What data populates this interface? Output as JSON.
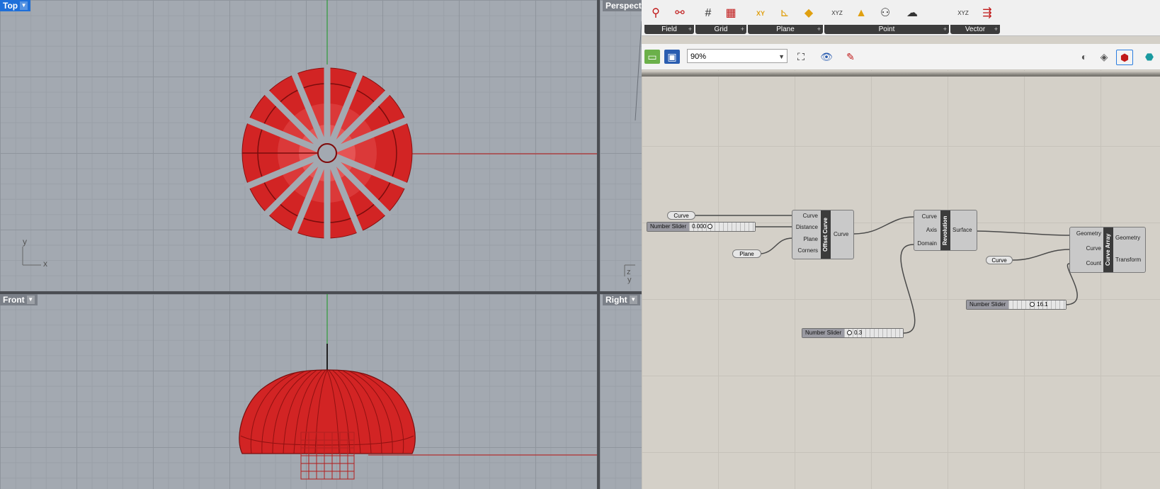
{
  "viewports": {
    "top": {
      "label": "Top"
    },
    "front": {
      "label": "Front"
    },
    "right": {
      "label": "Right"
    },
    "perspective": {
      "label": "Perspecti"
    }
  },
  "axes": {
    "top_y": "y",
    "top_x": "x",
    "persp_z": "z",
    "persp_y": "y"
  },
  "ribbon": {
    "groups": [
      "Field",
      "Grid",
      "Plane",
      "Point",
      "Vector"
    ],
    "icon_text": {
      "xy": "XY",
      "xyz": "XYZ",
      "xyz2": "XYZ"
    }
  },
  "toolbar": {
    "zoom": "90%"
  },
  "components": {
    "offset_curve": {
      "name": "Offset Curve",
      "inputs": [
        "Curve",
        "Distance",
        "Plane",
        "Corners"
      ],
      "outputs": [
        "Curve"
      ]
    },
    "revolution": {
      "name": "Revolution",
      "inputs": [
        "Curve",
        "Axis",
        "Domain"
      ],
      "outputs": [
        "Surface"
      ]
    },
    "curve_array": {
      "name": "Curve Array",
      "inputs": [
        "Geometry",
        "Curve",
        "Count"
      ],
      "outputs": [
        "Geometry",
        "Transform"
      ]
    }
  },
  "params": {
    "curve1": "Curve",
    "plane": "Plane",
    "curve2": "Curve"
  },
  "sliders": {
    "s1": {
      "label": "Number Slider",
      "value": "0.000"
    },
    "s2": {
      "label": "Number Slider",
      "value": "0.3"
    },
    "s3": {
      "label": "Number Slider",
      "value": "16.1"
    }
  },
  "colors": {
    "geometry": "#d11b1b",
    "active_tab": "#1e6fd9",
    "canvas": "#d4d0c8"
  }
}
